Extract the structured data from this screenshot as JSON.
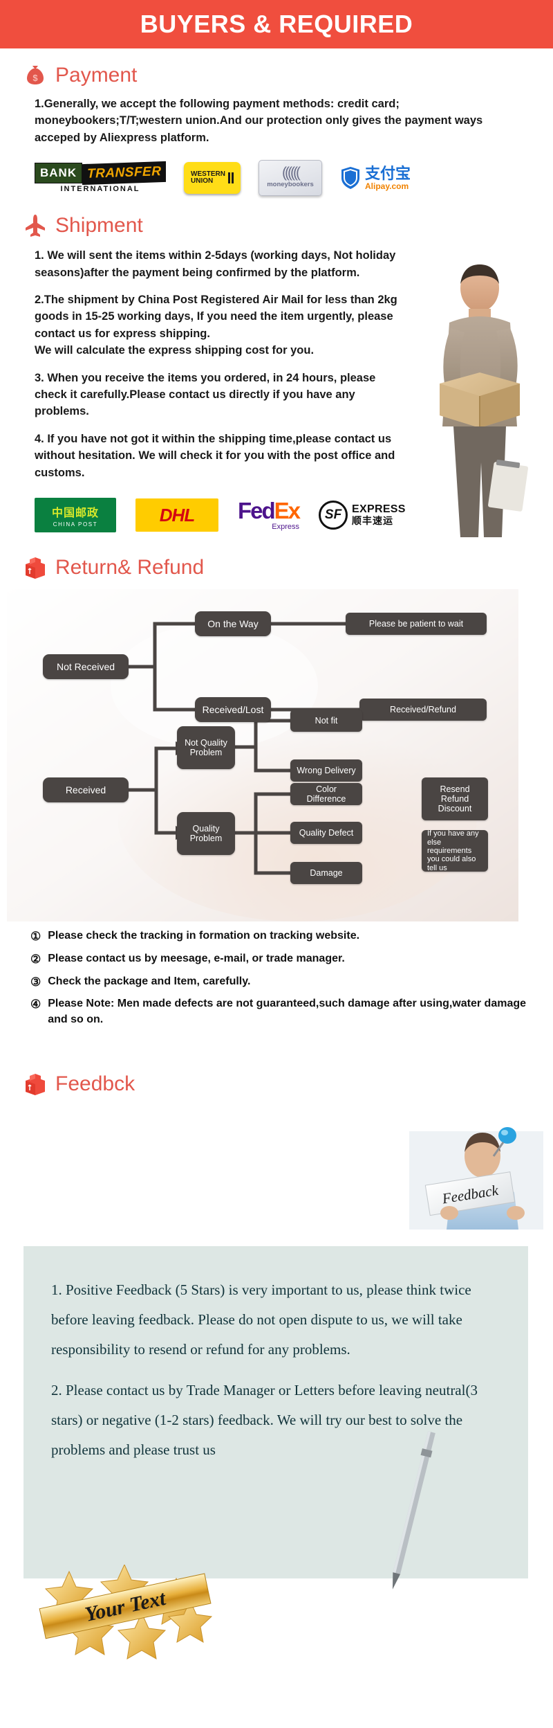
{
  "header": {
    "title": "BUYERS & REQUIRED",
    "bg": "#f04e3e",
    "text_color": "#ffffff"
  },
  "accent_color": "#e2574c",
  "sections": {
    "payment": {
      "icon": "money-bag-icon",
      "title": "Payment",
      "paragraphs": [
        "1.Generally, we accept the following payment methods: credit card; moneybookers;T/T;western union.And our protection only gives the payment ways acceped by Aliexpress platform."
      ],
      "logos": [
        {
          "name": "bank-transfer-logo",
          "line1": "BANK",
          "line2": "TRANSFER",
          "line3": "INTERNATIONAL"
        },
        {
          "name": "western-union-logo",
          "line1": "WESTERN",
          "line2": "UNION"
        },
        {
          "name": "moneybookers-logo",
          "label": "moneybookers"
        },
        {
          "name": "alipay-logo",
          "cn": "支付宝",
          "domain": "Alipay.com"
        }
      ]
    },
    "shipment": {
      "icon": "airplane-icon",
      "title": "Shipment",
      "paragraphs": [
        "1. We will sent the items within 2-5days (working days, Not holiday seasons)after the payment being confirmed by the platform.",
        "2.The shipment by China Post Registered Air Mail for less than  2kg goods in 15-25 working days, If  you need the item urgently, please contact us for express shipping.\nWe will calculate the express shipping cost for you.",
        "3. When you receive the items you ordered, in 24 hours, please check it carefully.Please contact us directly if you have any problems.",
        "4. If you have not got it within the shipping time,please contact us without hesitation. We will check it for you with the post office and customs."
      ],
      "carriers": [
        {
          "name": "china-post-logo",
          "cn": "中国邮政",
          "en": "CHINA POST"
        },
        {
          "name": "dhl-logo",
          "label": "DHL"
        },
        {
          "name": "fedex-logo",
          "part1": "Fed",
          "part2": "Ex",
          "sub": "Express"
        },
        {
          "name": "sf-express-logo",
          "mark": "SF",
          "en": "EXPRESS",
          "cn": "顺丰速运"
        }
      ]
    },
    "return_refund": {
      "icon": "open-box-icon",
      "title": "Return& Refund",
      "flowchart": {
        "nodes": [
          {
            "id": "not-received",
            "label": "Not Received"
          },
          {
            "id": "on-the-way",
            "label": "On the Way"
          },
          {
            "id": "received-lost",
            "label": "Received/Lost"
          },
          {
            "id": "be-patient",
            "label": "Please be patient to wait"
          },
          {
            "id": "received-refund",
            "label": "Received/Refund"
          },
          {
            "id": "received",
            "label": "Received"
          },
          {
            "id": "not-quality-problem",
            "label": "Not Quality Problem"
          },
          {
            "id": "quality-problem",
            "label": "Quality Problem"
          },
          {
            "id": "not-fit",
            "label": "Not fit"
          },
          {
            "id": "wrong-delivery",
            "label": "Wrong Delivery"
          },
          {
            "id": "color-difference",
            "label": "Color Difference"
          },
          {
            "id": "quality-defect",
            "label": "Quality Defect"
          },
          {
            "id": "damage",
            "label": "Damage"
          },
          {
            "id": "resend-refund-discount",
            "label": "Resend Refund Discount"
          },
          {
            "id": "else-requirements",
            "label": "If you have any else requirements you could also tell us"
          }
        ]
      },
      "notes": [
        {
          "num": "①",
          "text": "Please check the tracking in formation on tracking website."
        },
        {
          "num": "②",
          "text": "Please contact us by meesage, e-mail, or trade manager."
        },
        {
          "num": "③",
          "text": "Check the package and Item, carefully."
        },
        {
          "num": "④",
          "text": "Please Note: Men made defects  are not guaranteed,such damage after using,water damage and so on."
        }
      ]
    },
    "feedback": {
      "icon": "open-box-icon",
      "title": "Feedbck",
      "photo_label": "Feedback",
      "paragraphs": [
        "1. Positive Feedback (5 Stars) is very important to us, please think twice before leaving feedback. Please do not open dispute to us,   we will take responsibility to resend or refund for any problems.",
        "2. Please contact us by Trade Manager or Letters before leaving neutral(3 stars) or negative (1-2 stars) feedback. We will try our best to solve the problems and please trust us"
      ]
    },
    "ribbon": {
      "label": "Your Text"
    }
  }
}
